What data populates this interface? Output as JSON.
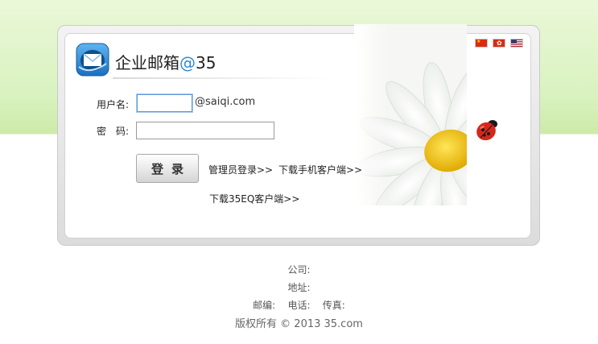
{
  "brand": {
    "name": "企业邮箱",
    "at": "@",
    "number": "35"
  },
  "languages": [
    {
      "name": "china-flag-icon"
    },
    {
      "name": "hong-kong-flag-icon"
    },
    {
      "name": "us-flag-icon"
    }
  ],
  "form": {
    "username_label": "用户名:",
    "username_value": "",
    "domain_suffix": "@saiqi.com",
    "password_label": "密　码:",
    "password_value": "",
    "login_button": "登录",
    "admin_login_link": "管理员登录>>",
    "mobile_client_link": "下载手机客户端>>",
    "eq_client_link": "下载35EQ客户端>>"
  },
  "footer": {
    "company": "公司:",
    "address": "地址:",
    "contact": "邮编:    电话:    传真:",
    "copyright": "版权所有 © 2013 35.com"
  },
  "colors": {
    "accent": "#2a8ad8",
    "top_band": "#d9f2bf",
    "daisy_center": "#f2c200",
    "ladybug": "#d8261b"
  }
}
